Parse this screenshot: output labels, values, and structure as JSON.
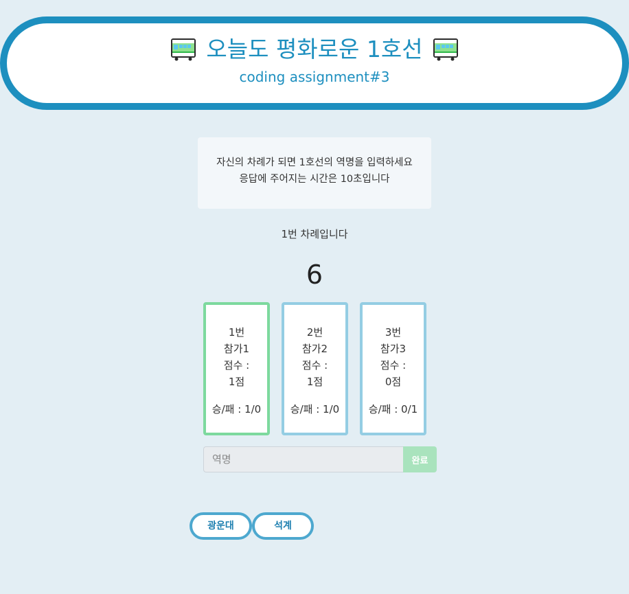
{
  "header": {
    "title": "오늘도 평화로운 1호선",
    "subtitle": "coding assignment#3",
    "left_icon": "train-icon",
    "right_icon": "train-icon"
  },
  "notice": {
    "line1": "자신의 차례가 되면 1호선의 역명을 입력하세요",
    "line2": "응답에 주어지는 시간은 10초입니다"
  },
  "turn_text": "1번 차례입니다",
  "timer": "6",
  "players": [
    {
      "order": "1번",
      "name": "참가1",
      "score_label": "점수 :",
      "score": "1점",
      "record": "승/패 : 1/0",
      "active": true
    },
    {
      "order": "2번",
      "name": "참가2",
      "score_label": "점수 :",
      "score": "1점",
      "record": "승/패 : 1/0",
      "active": false
    },
    {
      "order": "3번",
      "name": "참가3",
      "score_label": "점수 :",
      "score": "0점",
      "record": "승/패 : 0/1",
      "active": false
    }
  ],
  "answer": {
    "placeholder": "역명",
    "value": "",
    "submit_label": "완료"
  },
  "stations": [
    "광운대",
    "석계"
  ],
  "colors": {
    "accent": "#1d8fbf",
    "active_border": "#7dd99e",
    "inactive_border": "#94cde3",
    "submit_bg": "#a9e3bd",
    "background": "#e3eef4"
  }
}
